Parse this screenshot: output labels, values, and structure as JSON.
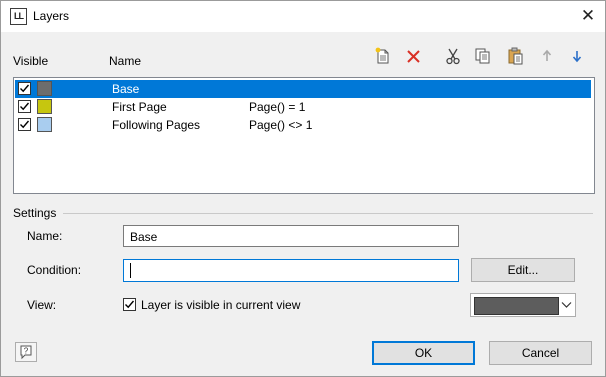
{
  "window": {
    "title": "Layers",
    "app_icon_text": "LL"
  },
  "columns": {
    "visible": "Visible",
    "name": "Name"
  },
  "toolbar": {
    "icons": [
      "new-icon",
      "delete-icon",
      "cut-icon",
      "copy-icon",
      "paste-icon",
      "move-up-icon",
      "move-down-icon"
    ]
  },
  "layers": [
    {
      "name": "Base",
      "condition": "",
      "color": "#6d6d6d",
      "checked": true,
      "selected": true
    },
    {
      "name": "First Page",
      "condition": "Page() = 1",
      "color": "#c6c60f",
      "checked": true,
      "selected": false
    },
    {
      "name": "Following Pages",
      "condition": "Page() <> 1",
      "color": "#a9cdef",
      "checked": true,
      "selected": false
    }
  ],
  "settings": {
    "group_label": "Settings",
    "name_label": "Name:",
    "name_value": "Base",
    "condition_label": "Condition:",
    "condition_value": "",
    "edit_button": "Edit...",
    "view_label": "View:",
    "visible_checkbox_label": "Layer is visible in current view",
    "visible_checked": true,
    "view_color": "#5d5d5d"
  },
  "buttons": {
    "ok": "OK",
    "cancel": "Cancel"
  },
  "colors": {
    "selection": "#0078d7",
    "delete_red": "#d93025",
    "arrow_blue": "#2a6fc9"
  }
}
